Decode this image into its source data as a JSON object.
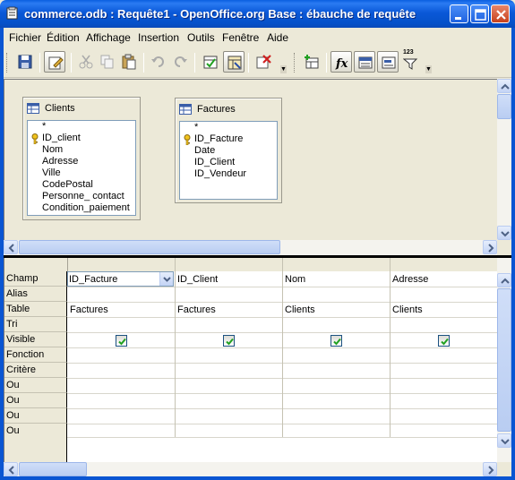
{
  "window": {
    "title": "commerce.odb : Requête1 - OpenOffice.org Base : ébauche de requête"
  },
  "menu": {
    "items": [
      "Fichier",
      "Édition",
      "Affichage",
      "Insertion",
      "Outils",
      "Fenêtre",
      "Aide"
    ]
  },
  "toolbar": {
    "buttons": [
      "save-icon",
      "edit-mode-icon",
      "cut-icon",
      "copy-icon",
      "paste-icon",
      "undo-icon",
      "redo-icon",
      "design-view-icon",
      "switch-design-view-icon",
      "clear-query-icon",
      "add-table-icon",
      "functions-icon",
      "table-name-icon",
      "alias-icon",
      "distinct-values-icon"
    ],
    "distinct_badge": "123"
  },
  "tables": [
    {
      "name": "Clients",
      "fields": [
        "*",
        "ID_client",
        "Nom",
        "Adresse",
        "Ville",
        "CodePostal",
        "Personne_ contact",
        "Condition_paiement"
      ],
      "key_field_index": 1
    },
    {
      "name": "Factures",
      "fields": [
        "*",
        "ID_Facture",
        "Date",
        "ID_Client",
        "ID_Vendeur"
      ],
      "key_field_index": 1
    }
  ],
  "grid": {
    "row_labels": [
      "Champ",
      "Alias",
      "Table",
      "Tri",
      "Visible",
      "Fonction",
      "Critère",
      "Ou",
      "Ou",
      "Ou",
      "Ou"
    ],
    "columns": [
      {
        "field": "ID_Facture",
        "table": "Factures",
        "visible": true
      },
      {
        "field": "ID_Client",
        "table": "Factures",
        "visible": true
      },
      {
        "field": "Nom",
        "table": "Clients",
        "visible": true
      },
      {
        "field": "Adresse",
        "table": "Clients",
        "visible": true
      }
    ]
  },
  "colors": {
    "titlebar": "#0a5fe0",
    "window_bg": "#ece9d8",
    "check": "#21a121"
  }
}
